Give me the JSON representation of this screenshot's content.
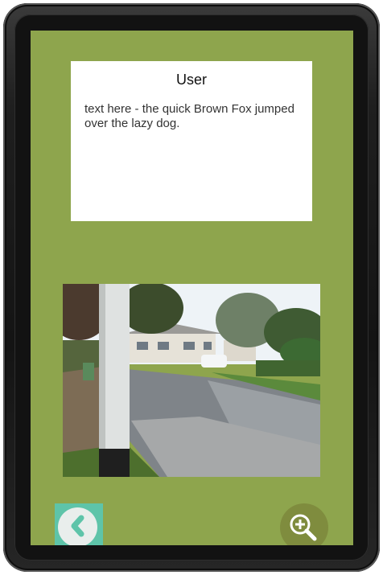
{
  "card": {
    "title": "User",
    "body": "text here - the quick Brown Fox jumped over the lazy dog."
  },
  "photo": {
    "subject": "street-scene-photo"
  },
  "buttons": {
    "back_icon": "chevron-left-icon",
    "zoom_icon": "zoom-in-icon"
  },
  "colors": {
    "screen_bg": "#8ea54d",
    "back_button": "#5ec4a9",
    "zoom_button": "#7f8c3e"
  }
}
